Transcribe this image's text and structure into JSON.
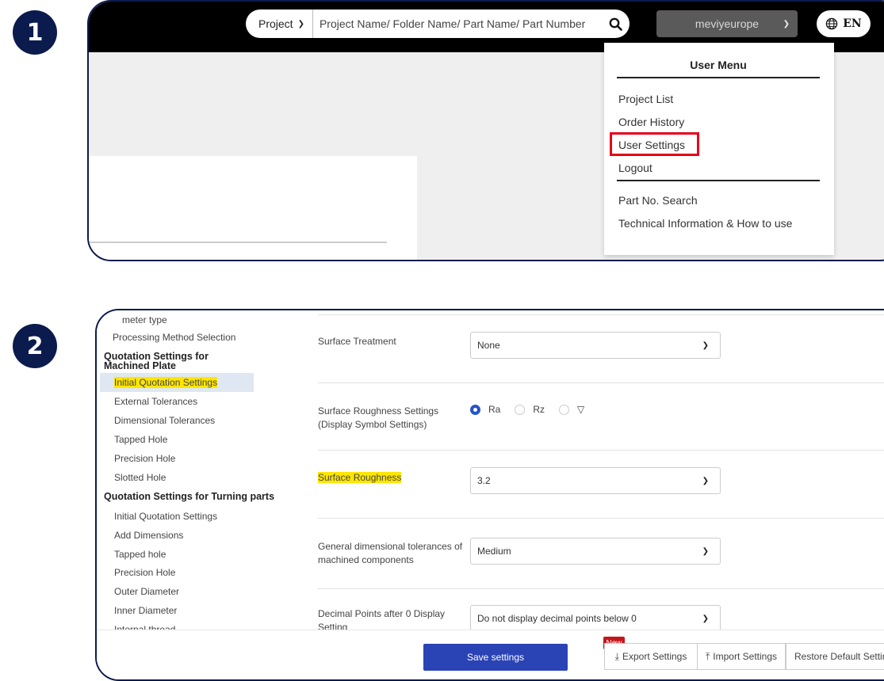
{
  "steps": [
    "1",
    "2"
  ],
  "header": {
    "search_scope": "Project",
    "search_placeholder": "Project Name/ Folder Name/ Part Name/ Part Number",
    "user_name": "meviyeurope",
    "language": "EN"
  },
  "user_menu": {
    "title": "User Menu",
    "items": [
      "Project List",
      "Order History",
      "User Settings",
      "Logout"
    ],
    "extra_items": [
      "Part No. Search",
      "Technical Information & How to use"
    ],
    "highlighted_item": "User Settings",
    "highlight_color": "#e5001b"
  },
  "sidebar": {
    "partial_top": "meter type",
    "processing_method": "Processing Method Selection",
    "machined_plate_heading": "Quotation Settings for Machined Plate",
    "machined_plate_items": [
      "Initial Quotation Settings",
      "External Tolerances",
      "Dimensional Tolerances",
      "Tapped Hole",
      "Precision Hole",
      "Slotted Hole"
    ],
    "turning_heading": "Quotation Settings for Turning parts",
    "turning_items": [
      "Initial Quotation Settings",
      "Add Dimensions",
      "Tapped hole",
      "Precision Hole",
      "Outer Diameter",
      "Inner Diameter",
      "Internal thread"
    ],
    "active_item": "Initial Quotation Settings"
  },
  "settings": {
    "surface_treatment": {
      "label": "Surface Treatment",
      "value": "None"
    },
    "roughness_symbol": {
      "label_line1": "Surface Roughness Settings",
      "label_line2": "(Display Symbol Settings)",
      "options": [
        "Ra",
        "Rz",
        "▽"
      ],
      "selected": "Ra"
    },
    "surface_roughness": {
      "label": "Surface Roughness",
      "value": "3.2"
    },
    "general_tolerance": {
      "label_line1": "General dimensional tolerances of",
      "label_line2": "machined components",
      "value": "Medium"
    },
    "decimal_points": {
      "label_line1": "Decimal Points after 0 Display",
      "label_line2": "Setting",
      "value": "Do not display decimal points below 0"
    }
  },
  "actions": {
    "save": "Save settings",
    "new_badge": "New",
    "export": "Export Settings",
    "import": "Import Settings",
    "restore": "Restore Default Settings"
  },
  "colors": {
    "badge_navy": "#0c1b4d",
    "primary_button": "#2a43b5",
    "highlight_yellow": "#ffe600"
  }
}
